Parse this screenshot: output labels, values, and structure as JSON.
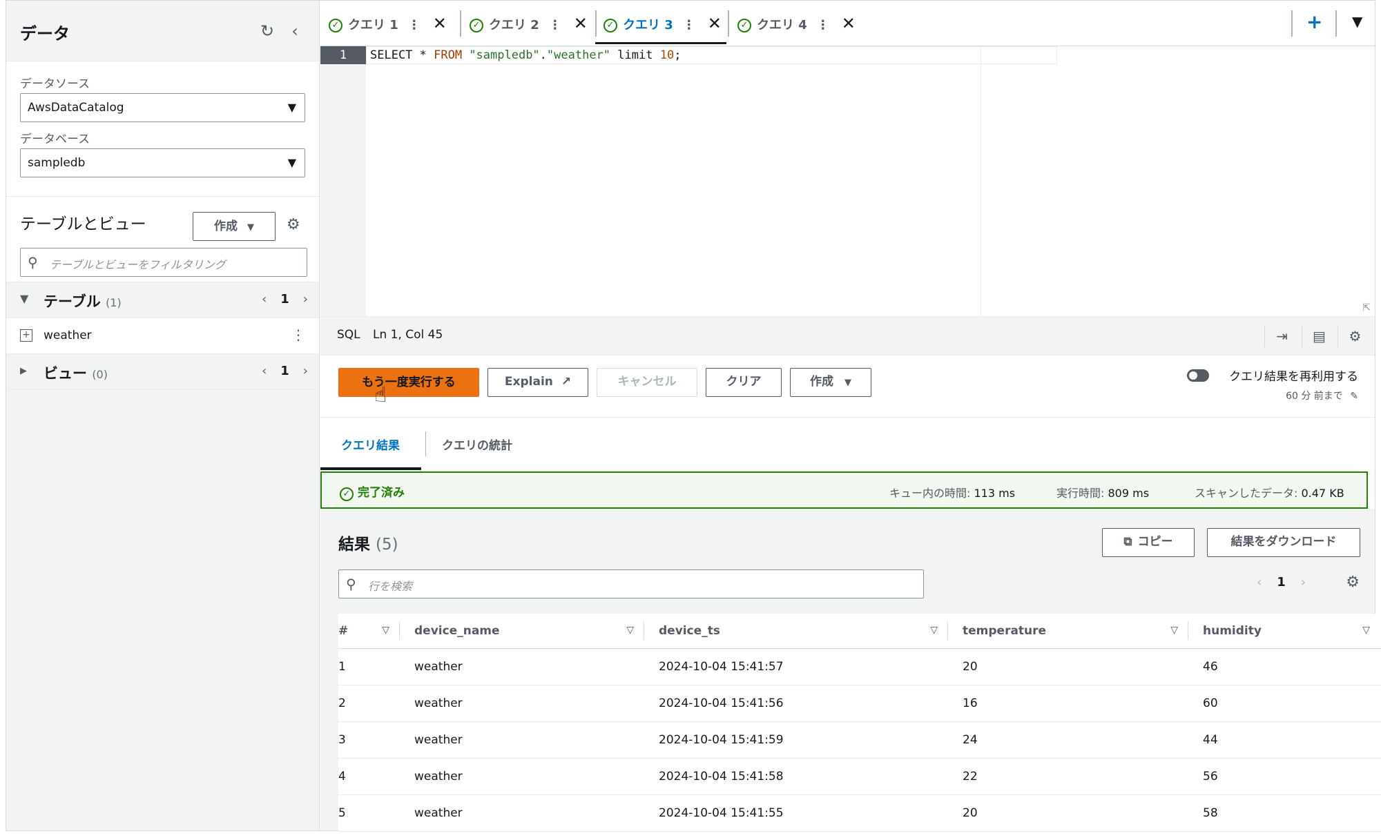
{
  "sidebar": {
    "title": "データ",
    "refresh_icon": "refresh-icon",
    "collapse_icon": "chevron-left-icon",
    "datasource_label": "データソース",
    "datasource_value": "AwsDataCatalog",
    "database_label": "データベース",
    "database_value": "sampledb",
    "tables_views_title": "テーブルとビュー",
    "create_label": "作成",
    "filter_placeholder": "テーブルとビューをフィルタリング",
    "tables": {
      "label": "テーブル",
      "count": "(1)",
      "page": "1",
      "items": [
        "weather"
      ]
    },
    "views": {
      "label": "ビュー",
      "count": "(0)",
      "page": "1"
    }
  },
  "tabs": [
    {
      "label": "クエリ 1",
      "active": false
    },
    {
      "label": "クエリ 2",
      "active": false
    },
    {
      "label": "クエリ 3",
      "active": true
    },
    {
      "label": "クエリ 4",
      "active": false
    }
  ],
  "editor": {
    "line_number": "1",
    "code_tokens": [
      {
        "t": "SELECT * ",
        "c": ""
      },
      {
        "t": "FROM ",
        "c": "kw"
      },
      {
        "t": "\"sampledb\"",
        "c": "str"
      },
      {
        "t": ".",
        "c": ""
      },
      {
        "t": "\"weather\"",
        "c": "str"
      },
      {
        "t": " limit ",
        "c": ""
      },
      {
        "t": "10",
        "c": "num"
      },
      {
        "t": ";",
        "c": ""
      }
    ]
  },
  "statusbar": {
    "language": "SQL",
    "position": "Ln 1, Col 45"
  },
  "actions": {
    "run_again": "もう一度実行する",
    "explain": "Explain",
    "cancel": "キャンセル",
    "clear": "クリア",
    "create": "作成",
    "reuse_label": "クエリ結果を再利用する",
    "reuse_sub": "60 分 前まで"
  },
  "result_tabs": [
    "クエリ結果",
    "クエリの統計"
  ],
  "status": {
    "text": "完了済み",
    "queue_label": "キュー内の時間:",
    "queue_value": "113 ms",
    "exec_label": "実行時間:",
    "exec_value": "809 ms",
    "scan_label": "スキャンしたデータ:",
    "scan_value": "0.47 KB"
  },
  "results": {
    "title": "結果",
    "count": "(5)",
    "copy": "コピー",
    "download": "結果をダウンロード",
    "search_placeholder": "行を検索",
    "page": "1",
    "columns": [
      "#",
      "device_name",
      "device_ts",
      "temperature",
      "humidity"
    ],
    "rows": [
      [
        "1",
        "weather",
        "2024-10-04 15:41:57",
        "20",
        "46"
      ],
      [
        "2",
        "weather",
        "2024-10-04 15:41:56",
        "16",
        "60"
      ],
      [
        "3",
        "weather",
        "2024-10-04 15:41:59",
        "24",
        "44"
      ],
      [
        "4",
        "weather",
        "2024-10-04 15:41:58",
        "22",
        "56"
      ],
      [
        "5",
        "weather",
        "2024-10-04 15:41:55",
        "20",
        "58"
      ]
    ]
  },
  "colors": {
    "accent": "#ec7211",
    "link": "#0073bb",
    "success": "#1d8102"
  }
}
